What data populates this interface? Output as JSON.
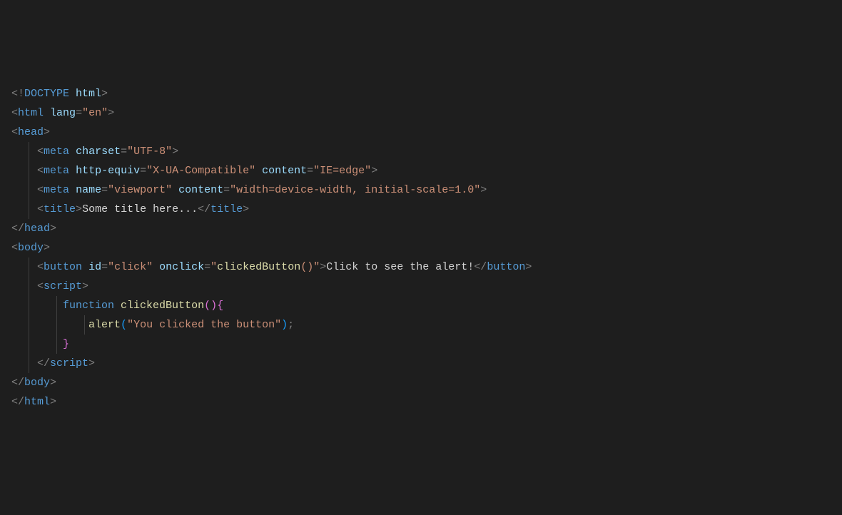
{
  "code": {
    "doctype": {
      "open": "<!",
      "name": "DOCTYPE",
      "arg": " html",
      "close": ">"
    },
    "htmlOpen": {
      "lt": "<",
      "tag": "html",
      "sp": " ",
      "attr": "lang",
      "eq": "=",
      "val": "\"en\"",
      "gt": ">"
    },
    "headOpen": {
      "lt": "<",
      "tag": "head",
      "gt": ">"
    },
    "meta1": {
      "lt": "<",
      "tag": "meta",
      "sp": " ",
      "a1": "charset",
      "eq": "=",
      "v1": "\"UTF-8\"",
      "gt": ">"
    },
    "meta2": {
      "lt": "<",
      "tag": "meta",
      "sp1": " ",
      "a1": "http-equiv",
      "eq1": "=",
      "v1": "\"X-UA-Compatible\"",
      "sp2": " ",
      "a2": "content",
      "eq2": "=",
      "v2": "\"IE=edge\"",
      "gt": ">"
    },
    "meta3": {
      "lt": "<",
      "tag": "meta",
      "sp1": " ",
      "a1": "name",
      "eq1": "=",
      "v1": "\"viewport\"",
      "sp2": " ",
      "a2": "content",
      "eq2": "=",
      "v2": "\"width=device-width, initial-scale=1.0\"",
      "gt": ">"
    },
    "title": {
      "lt": "<",
      "tag": "title",
      "gt": ">",
      "text": "Some title here...",
      "lt2": "</",
      "tag2": "title",
      "gt2": ">"
    },
    "headClose": {
      "lt": "</",
      "tag": "head",
      "gt": ">"
    },
    "bodyOpen": {
      "lt": "<",
      "tag": "body",
      "gt": ">"
    },
    "button": {
      "lt": "<",
      "tag": "button",
      "sp1": " ",
      "a1": "id",
      "eq1": "=",
      "v1": "\"click\"",
      "sp2": " ",
      "a2": "onclick",
      "eq2": "=",
      "q": "\"",
      "fn": "clickedButton",
      "paren": "()",
      "q2": "\"",
      "gt": ">",
      "text": "Click to see the alert!",
      "lt2": "</",
      "tag2": "button",
      "gt2": ">"
    },
    "scriptOpen": {
      "lt": "<",
      "tag": "script",
      "gt": ">"
    },
    "fnLine": {
      "kw": "function",
      "sp": " ",
      "name": "clickedButton",
      "paren": "()",
      "brace": "{"
    },
    "alertLine": {
      "fn": "alert",
      "po": "(",
      "str": "\"You clicked the button\"",
      "pc": ")",
      "semi": ";"
    },
    "closeBrace": {
      "brace": "}"
    },
    "scriptClose": {
      "lt": "</",
      "tag": "script",
      "gt": ">"
    },
    "bodyClose": {
      "lt": "</",
      "tag": "body",
      "gt": ">"
    },
    "htmlClose": {
      "lt": "</",
      "tag": "html",
      "gt": ">"
    }
  }
}
